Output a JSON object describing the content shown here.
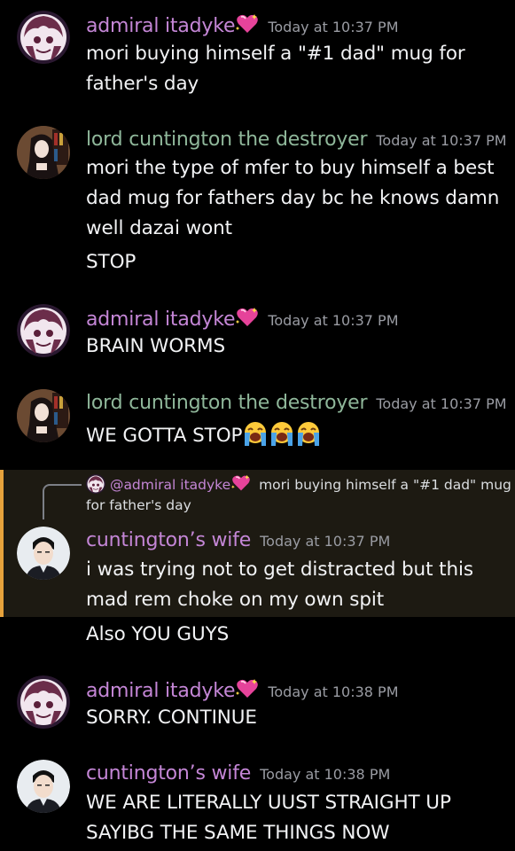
{
  "messages": [
    {
      "author": "admiral itadyke",
      "time": "Today at 10:37 PM",
      "lines": [
        "mori buying himself a \"#1 dad\" mug for",
        "father's day"
      ]
    },
    {
      "author": "lord cuntington the destroyer",
      "time": "Today at 10:37 PM",
      "lines": [
        "mori the type of mfer to buy himself a best",
        "dad mug for fathers day bc he knows damn",
        "well dazai wont",
        "STOP"
      ]
    },
    {
      "author": "admiral itadyke",
      "time": "Today at 10:37 PM",
      "lines": [
        "BRAIN WORMS"
      ]
    },
    {
      "author": "lord cuntington the destroyer",
      "time": "Today at 10:37 PM",
      "lines": [
        "WE GOTTA STOP"
      ]
    },
    {
      "reply": {
        "mention": "@admiral itadyke",
        "text_line1": "mori buying himself a \"#1 dad\" mug",
        "text_line2": "for father's day"
      },
      "author": "cuntington’s wife",
      "time": "Today at 10:37 PM",
      "lines": [
        "i was trying not to get distracted but this",
        "mad rem choke on my own spit",
        "Also YOU GUYS"
      ]
    },
    {
      "author": "admiral itadyke",
      "time": "Today at 10:38 PM",
      "lines": [
        "SORRY. CONTINUE"
      ]
    },
    {
      "author": "cuntington’s wife",
      "time": "Today at 10:38 PM",
      "lines": [
        "WE ARE LITERALLY UUST STRAIGHT UP",
        "SAYIBG THE SAME THINGS NOW"
      ]
    }
  ],
  "colors": {
    "admiral": "#c486d6",
    "lord": "#8fb79a",
    "wife": "#c486d6",
    "highlight_bar": "#e6a23c"
  },
  "icons": {
    "heart": "sparkling-heart-icon",
    "crying": "loudly-crying-face-icon"
  }
}
